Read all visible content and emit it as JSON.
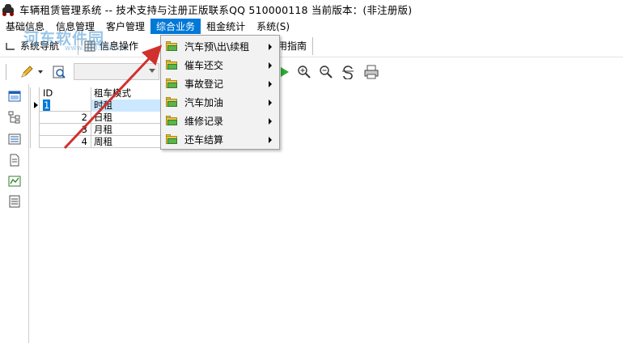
{
  "window": {
    "title": "车辆租赁管理系统 -- 技术支持与注册正版联系QQ 510000118    当前版本：(非注册版)"
  },
  "menubar": {
    "items": [
      {
        "label": "基础信息"
      },
      {
        "label": "信息管理"
      },
      {
        "label": "客户管理"
      },
      {
        "label": "综合业务"
      },
      {
        "label": "租金统计"
      },
      {
        "label": "系统(S)"
      }
    ]
  },
  "toolbar1": {
    "nav_label": "系统导航",
    "info_label": "信息操作",
    "guide_label": "用指南"
  },
  "dropdown": {
    "items": [
      {
        "label": "汽车预\\出\\续租"
      },
      {
        "label": "催车还交"
      },
      {
        "label": "事故登记"
      },
      {
        "label": "汽车加油"
      },
      {
        "label": "维修记录"
      },
      {
        "label": "还车结算"
      }
    ]
  },
  "grid": {
    "columns": [
      "ID",
      "租车模式"
    ],
    "rows": [
      {
        "id": "1",
        "mode": "时租"
      },
      {
        "id": "2",
        "mode": "日租"
      },
      {
        "id": "3",
        "mode": "月租"
      },
      {
        "id": "4",
        "mode": "周租"
      }
    ]
  },
  "watermark": {
    "text": "河东软件园",
    "url": "www.pc0359.cn"
  },
  "colors": {
    "menu_highlight": "#0078d7",
    "arrow": "#d0312d"
  }
}
